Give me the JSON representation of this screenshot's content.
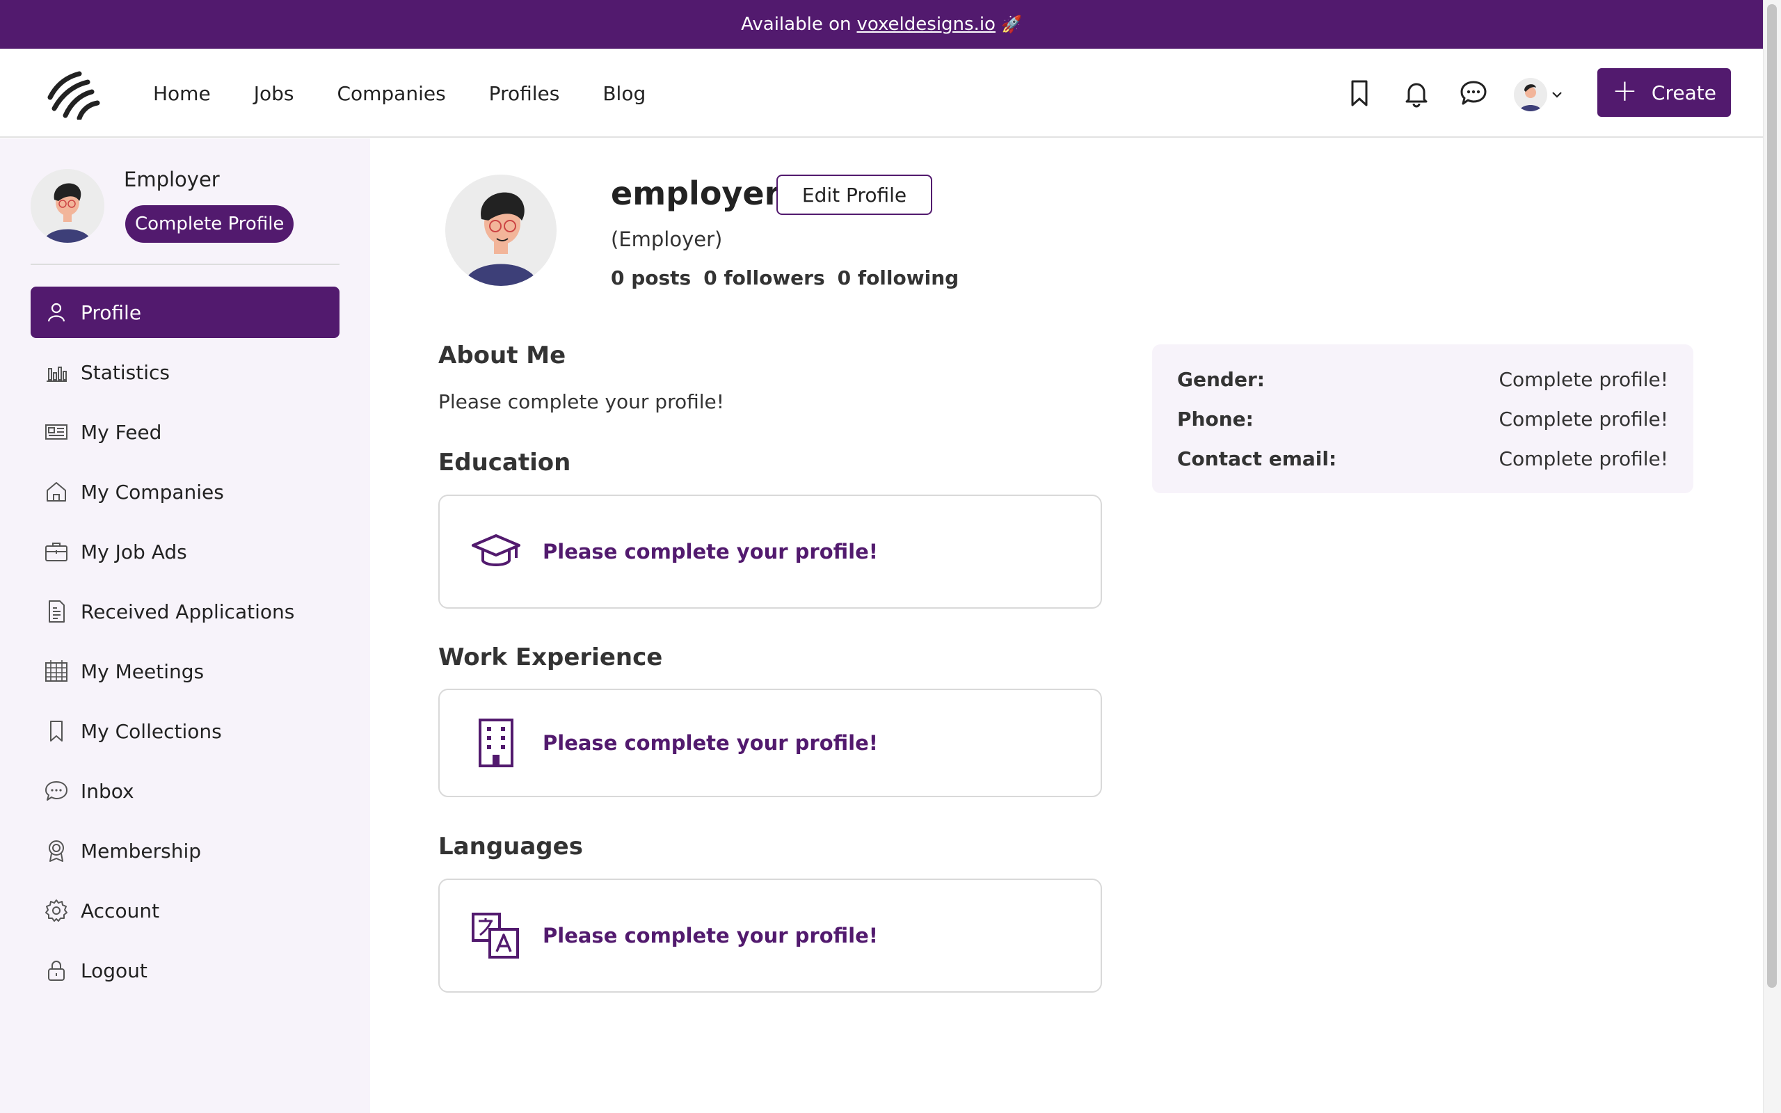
{
  "announcement": {
    "prefix": "Available on",
    "link": "voxeldesigns.io",
    "emoji": "🚀"
  },
  "header": {
    "nav": [
      "Home",
      "Jobs",
      "Companies",
      "Profiles",
      "Blog"
    ],
    "create_label": "Create"
  },
  "sidebar": {
    "user_name": "Employer",
    "complete_profile_label": "Complete Profile",
    "items": [
      {
        "label": "Profile",
        "icon": "user-icon",
        "active": true
      },
      {
        "label": "Statistics",
        "icon": "bar-chart-icon"
      },
      {
        "label": "My Feed",
        "icon": "newspaper-icon"
      },
      {
        "label": "My Companies",
        "icon": "home-icon"
      },
      {
        "label": "My Job Ads",
        "icon": "briefcase-icon"
      },
      {
        "label": "Received Applications",
        "icon": "document-icon"
      },
      {
        "label": "My Meetings",
        "icon": "calendar-icon"
      },
      {
        "label": "My Collections",
        "icon": "bookmark-icon"
      },
      {
        "label": "Inbox",
        "icon": "chat-icon"
      },
      {
        "label": "Membership",
        "icon": "badge-icon"
      },
      {
        "label": "Account",
        "icon": "gear-icon"
      },
      {
        "label": "Logout",
        "icon": "lock-icon"
      }
    ]
  },
  "profile": {
    "name": "employer",
    "edit_label": "Edit Profile",
    "role": "(Employer)",
    "posts": "0 posts",
    "followers": "0 followers",
    "following": "0 following"
  },
  "sections": {
    "about_title": "About Me",
    "about_text": "Please complete your profile!",
    "education_title": "Education",
    "education_msg": "Please complete your profile!",
    "work_title": "Work Experience",
    "work_msg": "Please complete your profile!",
    "languages_title": "Languages",
    "languages_msg": "Please complete your profile!"
  },
  "info": [
    {
      "key": "Gender:",
      "value": "Complete profile!"
    },
    {
      "key": "Phone:",
      "value": "Complete profile!"
    },
    {
      "key": "Contact email:",
      "value": "Complete profile!"
    }
  ],
  "colors": {
    "brand": "#521a6e",
    "sidebar_bg": "#f7f3fa"
  }
}
